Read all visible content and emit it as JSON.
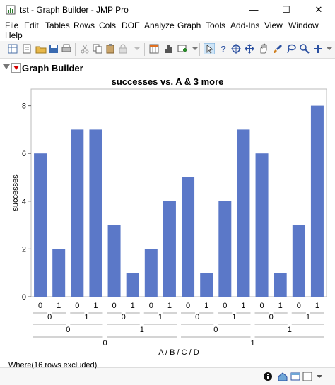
{
  "window": {
    "title": "tst - Graph Builder - JMP Pro",
    "minimize": "—",
    "maximize": "☐",
    "close": "✕"
  },
  "menu": [
    "File",
    "Edit",
    "Tables",
    "Rows",
    "Cols",
    "DOE",
    "Analyze",
    "Graph",
    "Tools",
    "Add-Ins",
    "View",
    "Window",
    "Help"
  ],
  "panel": {
    "title": "Graph Builder"
  },
  "status": {
    "where": "Where(16 rows excluded)"
  },
  "colors": {
    "bar": "#5b78c8",
    "accent_red": "#d40000"
  },
  "chart_data": {
    "type": "bar",
    "title": "successes vs. A & 3 more",
    "xlabel": "A / B / C / D",
    "ylabel": "successes",
    "ylim": [
      0,
      8.5
    ],
    "yticks": [
      0,
      2,
      4,
      6,
      8
    ],
    "levels": {
      "D": [
        "0",
        "1",
        "0",
        "1",
        "0",
        "1",
        "0",
        "1",
        "0",
        "1",
        "0",
        "1",
        "0",
        "1",
        "0",
        "1"
      ],
      "C": [
        "0",
        "1",
        "0",
        "1",
        "0",
        "1",
        "0",
        "1"
      ],
      "B": [
        "0",
        "1",
        "0",
        "1"
      ],
      "A": [
        "0",
        "1"
      ]
    },
    "values": [
      6,
      2,
      7,
      7,
      3,
      1,
      2,
      4,
      5,
      1,
      4,
      7,
      6,
      1,
      3,
      8
    ]
  }
}
